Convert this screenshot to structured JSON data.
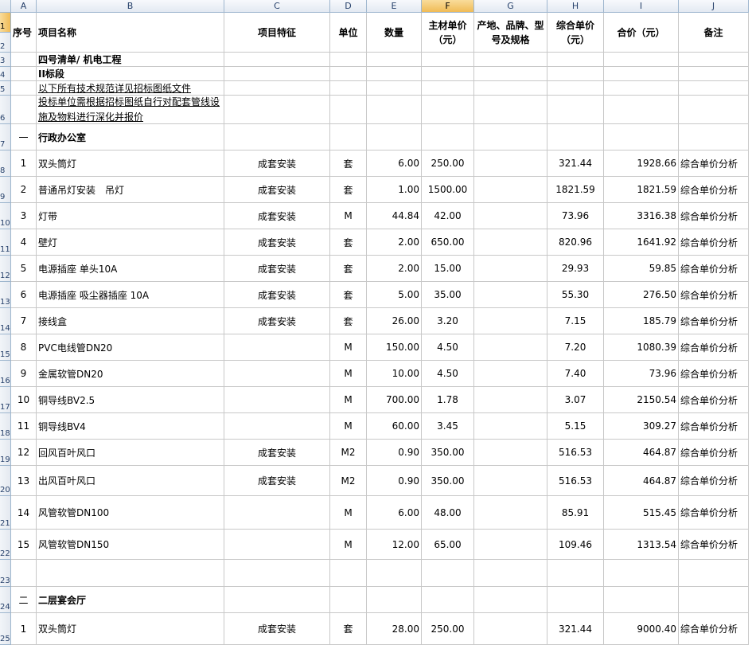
{
  "columns": [
    "A",
    "B",
    "C",
    "D",
    "E",
    "F",
    "G",
    "H",
    "I",
    "J"
  ],
  "selected_column": "F",
  "header": {
    "seq": "序号",
    "name": "项目名称",
    "feature": "项目特征",
    "unit": "单位",
    "qty": "数量",
    "material_price": "主材单价（元）",
    "origin": "产地、品牌、型号及规格",
    "unit_price": "综合单价（元）",
    "total": "合价（元）",
    "note": "备注"
  },
  "title_rows": [
    {
      "row": "3",
      "text": "四号清单/ 机电工程"
    },
    {
      "row": "4",
      "text": "II标段"
    },
    {
      "row": "5",
      "text": "以下所有技术规范详见招标图纸文件"
    },
    {
      "row": "6",
      "text": "投标单位需根据招标图纸自行对配套管线设施及物料进行深化并报价"
    }
  ],
  "section1": {
    "row": "7",
    "seq": "一",
    "name": "行政办公室"
  },
  "items": [
    {
      "row": "8",
      "seq": "1",
      "name": "双头筒灯",
      "feature": "成套安装",
      "unit": "套",
      "qty": "6.00",
      "mp": "250.00",
      "origin": "",
      "up": "321.44",
      "total": "1928.66",
      "note": "综合单价分析"
    },
    {
      "row": "9",
      "seq": "2",
      "name": "普通吊灯安装　吊灯",
      "feature": "成套安装",
      "unit": "套",
      "qty": "1.00",
      "mp": "1500.00",
      "origin": "",
      "up": "1821.59",
      "total": "1821.59",
      "note": "综合单价分析"
    },
    {
      "row": "10",
      "seq": "3",
      "name": "灯带",
      "feature": "成套安装",
      "unit": "M",
      "qty": "44.84",
      "mp": "42.00",
      "origin": "",
      "up": "73.96",
      "total": "3316.38",
      "note": "综合单价分析"
    },
    {
      "row": "11",
      "seq": "4",
      "name": "壁灯",
      "feature": "成套安装",
      "unit": "套",
      "qty": "2.00",
      "mp": "650.00",
      "origin": "",
      "up": "820.96",
      "total": "1641.92",
      "note": "综合单价分析"
    },
    {
      "row": "12",
      "seq": "5",
      "name": "电源插座 单头10A",
      "feature": "成套安装",
      "unit": "套",
      "qty": "2.00",
      "mp": "15.00",
      "origin": "",
      "up": "29.93",
      "total": "59.85",
      "note": "综合单价分析"
    },
    {
      "row": "13",
      "seq": "6",
      "name": "电源插座 吸尘器插座 10A",
      "feature": "成套安装",
      "unit": "套",
      "qty": "5.00",
      "mp": "35.00",
      "origin": "",
      "up": "55.30",
      "total": "276.50",
      "note": "综合单价分析"
    },
    {
      "row": "14",
      "seq": "7",
      "name": "接线盒",
      "feature": "成套安装",
      "unit": "套",
      "qty": "26.00",
      "mp": "3.20",
      "origin": "",
      "up": "7.15",
      "total": "185.79",
      "note": "综合单价分析"
    },
    {
      "row": "15",
      "seq": "8",
      "name": "PVC电线管DN20",
      "feature": "",
      "unit": "M",
      "qty": "150.00",
      "mp": "4.50",
      "origin": "",
      "up": "7.20",
      "total": "1080.39",
      "note": "综合单价分析"
    },
    {
      "row": "16",
      "seq": "9",
      "name": "金属软管DN20",
      "feature": "",
      "unit": "M",
      "qty": "10.00",
      "mp": "4.50",
      "origin": "",
      "up": "7.40",
      "total": "73.96",
      "note": "综合单价分析"
    },
    {
      "row": "17",
      "seq": "10",
      "name": "铜导线BV2.5",
      "feature": "",
      "unit": "M",
      "qty": "700.00",
      "mp": "1.78",
      "origin": "",
      "up": "3.07",
      "total": "2150.54",
      "note": "综合单价分析"
    },
    {
      "row": "18",
      "seq": "11",
      "name": "铜导线BV4",
      "feature": "",
      "unit": "M",
      "qty": "60.00",
      "mp": "3.45",
      "origin": "",
      "up": "5.15",
      "total": "309.27",
      "note": "综合单价分析"
    },
    {
      "row": "19",
      "seq": "12",
      "name": "回风百叶风口",
      "feature": "成套安装",
      "unit": "M2",
      "qty": "0.90",
      "mp": "350.00",
      "origin": "",
      "up": "516.53",
      "total": "464.87",
      "note": "综合单价分析"
    },
    {
      "row": "20",
      "seq": "13",
      "name": "出风百叶风口",
      "feature": "成套安装",
      "unit": "M2",
      "qty": "0.90",
      "mp": "350.00",
      "origin": "",
      "up": "516.53",
      "total": "464.87",
      "note": "综合单价分析"
    },
    {
      "row": "21",
      "seq": "14",
      "name": "风管软管DN100",
      "feature": "",
      "unit": "M",
      "qty": "6.00",
      "mp": "48.00",
      "origin": "",
      "up": "85.91",
      "total": "515.45",
      "note": "综合单价分析"
    },
    {
      "row": "22",
      "seq": "15",
      "name": "风管软管DN150",
      "feature": "",
      "unit": "M",
      "qty": "12.00",
      "mp": "65.00",
      "origin": "",
      "up": "109.46",
      "total": "1313.54",
      "note": "综合单价分析"
    }
  ],
  "blank_row": "23",
  "section2": {
    "row": "24",
    "seq": "二",
    "name": "二层宴会厅"
  },
  "last_item": {
    "row": "25",
    "seq": "1",
    "name": "双头筒灯",
    "feature": "成套安装",
    "unit": "套",
    "qty": "28.00",
    "mp": "250.00",
    "origin": "",
    "up": "321.44",
    "total": "9000.40",
    "note": "综合单价分析"
  }
}
